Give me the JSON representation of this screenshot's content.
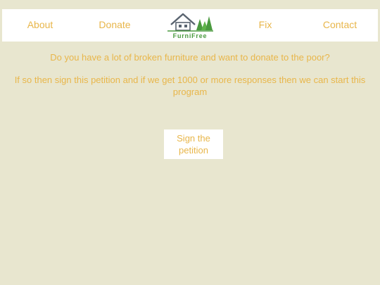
{
  "nav": {
    "items": [
      {
        "label": "About"
      },
      {
        "label": "Donate"
      },
      {
        "label": "Fix"
      },
      {
        "label": "Contact"
      }
    ],
    "logo_text": "FurniFree"
  },
  "content": {
    "line1": "Do you have a lot of broken furniture and want to donate to the poor?",
    "line2": "If so then sign this petition and if we get 1000 or more responses then we can start this program"
  },
  "cta": {
    "label": "Sign the petition"
  },
  "colors": {
    "background": "#e8e6cf",
    "text": "#e8b64a",
    "logo_green": "#4a9a3f",
    "logo_gray": "#5a6470",
    "panel": "#ffffff"
  }
}
